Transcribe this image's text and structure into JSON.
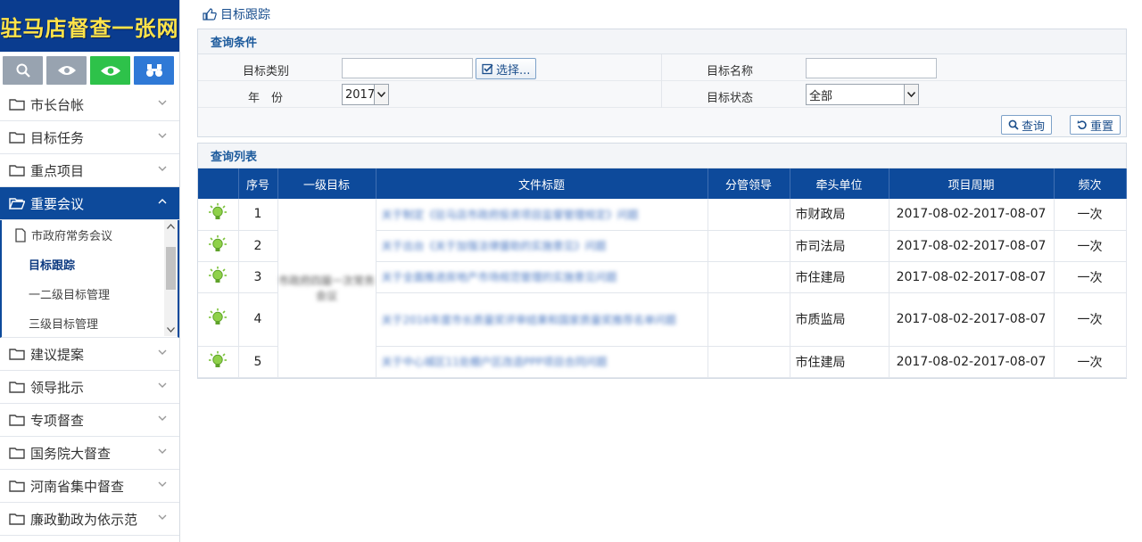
{
  "banner": {
    "title": "驻马店督查一张网"
  },
  "sidebar": {
    "icons": [
      "search-icon",
      "eye-outline-icon",
      "eye-icon",
      "binoculars-icon"
    ],
    "items_top": [
      {
        "label": "市长台帐"
      },
      {
        "label": "目标任务"
      },
      {
        "label": "重点项目"
      }
    ],
    "active": {
      "label": "重要会议"
    },
    "sub_items": [
      {
        "label": "市政府常务会议"
      },
      {
        "label": "目标跟踪"
      },
      {
        "label": "一二级目标管理"
      },
      {
        "label": "三级目标管理"
      }
    ],
    "items_bottom": [
      {
        "label": "建议提案"
      },
      {
        "label": "领导批示"
      },
      {
        "label": "专项督查"
      },
      {
        "label": "国务院大督查"
      },
      {
        "label": "河南省集中督查"
      },
      {
        "label": "廉政勤政为依示范"
      }
    ]
  },
  "breadcrumb": {
    "label": "目标跟踪"
  },
  "query": {
    "title": "查询条件",
    "category_label": "目标类别",
    "category_value": "",
    "choose_label": "选择...",
    "name_label": "目标名称",
    "name_value": "",
    "year_label": "年　份",
    "year_value": "2017",
    "status_label": "目标状态",
    "status_value": "全部",
    "search_label": "查询",
    "reset_label": "重置"
  },
  "list": {
    "title": "查询列表",
    "columns": [
      "",
      "序号",
      "一级目标",
      "文件标题",
      "分管领导",
      "牵头单位",
      "项目周期",
      "频次"
    ],
    "merged_goal": "市政府四届一次常务会议",
    "rows": [
      {
        "no": "1",
        "title": "关于制定《驻马店市政府投资项目监督管理规定》问题",
        "leader": "",
        "unit": "市财政局",
        "period": "2017-08-02-2017-08-07",
        "freq": "一次"
      },
      {
        "no": "2",
        "title": "关于出台《关于加强法律援助的实施意见》问题",
        "leader": "",
        "unit": "市司法局",
        "period": "2017-08-02-2017-08-07",
        "freq": "一次"
      },
      {
        "no": "3",
        "title": "关于全面推进房地产市场规范管理的实施意见问题",
        "leader": "",
        "unit": "市住建局",
        "period": "2017-08-02-2017-08-07",
        "freq": "一次"
      },
      {
        "no": "4",
        "title": "关于2016年度市长质量奖评审结果和国家质量奖推荐名单问题",
        "leader": "",
        "unit": "市质监局",
        "period": "2017-08-02-2017-08-07",
        "freq": "一次"
      },
      {
        "no": "5",
        "title": "关于中心城区11处棚户区改造PPP项目合同问题",
        "leader": "",
        "unit": "市住建局",
        "period": "2017-08-02-2017-08-07",
        "freq": "一次"
      }
    ]
  },
  "colors": {
    "brand": "#0d4a9b",
    "banner_text": "#ffe34a",
    "accent_green": "#2ec24a",
    "accent_blue": "#2f79d6"
  }
}
